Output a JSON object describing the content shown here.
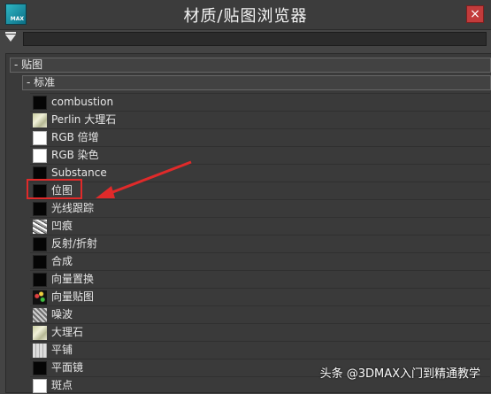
{
  "window": {
    "title": "材质/贴图浏览器",
    "app_icon_text": "MAX",
    "close_label": "×"
  },
  "search": {
    "value": "",
    "placeholder": ""
  },
  "tree": {
    "root_label": "- 贴图",
    "standard_label": "- 标准",
    "items": [
      {
        "label": "combustion",
        "swatch": "black"
      },
      {
        "label": "Perlin 大理石",
        "swatch": "marble"
      },
      {
        "label": "RGB 倍增",
        "swatch": "white"
      },
      {
        "label": "RGB 染色",
        "swatch": "white"
      },
      {
        "label": "Substance",
        "swatch": "black"
      },
      {
        "label": "位图",
        "swatch": "black"
      },
      {
        "label": "光线跟踪",
        "swatch": "black"
      },
      {
        "label": "凹痕",
        "swatch": "dents"
      },
      {
        "label": "反射/折射",
        "swatch": "black"
      },
      {
        "label": "合成",
        "swatch": "black"
      },
      {
        "label": "向量置换",
        "swatch": "black"
      },
      {
        "label": "向量贴图",
        "swatch": "vector"
      },
      {
        "label": "噪波",
        "swatch": "noise"
      },
      {
        "label": "大理石",
        "swatch": "marble"
      },
      {
        "label": "平铺",
        "swatch": "checker"
      },
      {
        "label": "平面镜",
        "swatch": "black"
      },
      {
        "label": "斑点",
        "swatch": "white"
      }
    ]
  },
  "annotation": {
    "highlighted_item": "位图",
    "color": "#e02a2a"
  },
  "watermark": "头条 @3DMAX入门到精通教学"
}
